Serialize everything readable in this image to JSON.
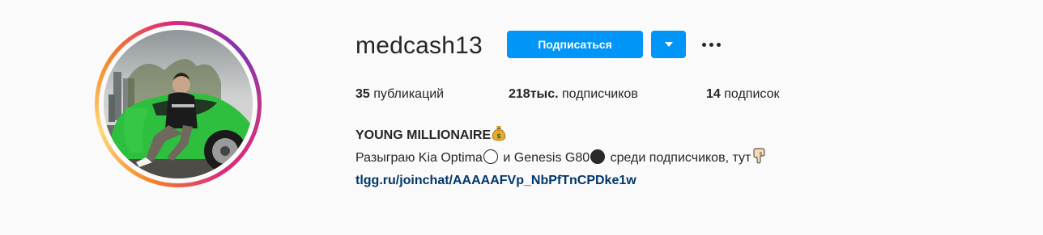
{
  "profile": {
    "username": "medcash13",
    "follow_label": "Подписаться",
    "stats": {
      "posts_count": "35",
      "posts_label": "публикаций",
      "followers_count": "218тыс.",
      "followers_label": "подписчиков",
      "following_count": "14",
      "following_label": "подписок"
    },
    "bio": {
      "name": "YOUNG MILLIONAIRE",
      "line_part1": "Разыграю Kia Optima",
      "line_part2": "и Genesis G80",
      "line_part3": "среди подписчиков, тут",
      "link": "tlgg.ru/joinchat/AAAAAFVp_NbPfTnCPDke1w"
    }
  },
  "icons": {
    "money_bag": "money-bag-icon",
    "white_circle": "white-circle-icon",
    "black_circle": "black-circle-icon",
    "pointing_hand": "backhand-index-pointing-down-icon",
    "dropdown": "chevron-down-icon",
    "more": "more-options-icon"
  },
  "colors": {
    "accent": "#0095f6",
    "link": "#00376b",
    "text": "#262626",
    "background": "#fafafa"
  }
}
